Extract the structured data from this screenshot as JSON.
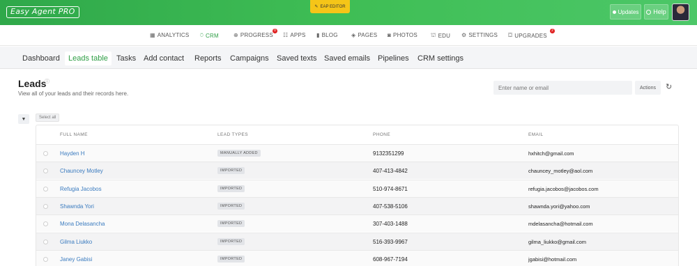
{
  "header": {
    "logo": "Easy Agent PRO",
    "eap_editor": "EAP EDITOR",
    "updates_label": "Updates",
    "help_label": "Help"
  },
  "main_nav": [
    {
      "label": "ANALYTICS",
      "icon": "analytics-icon",
      "glyph": "▦",
      "badge": ""
    },
    {
      "label": "CRM",
      "icon": "crm-icon",
      "glyph": "⍥",
      "badge": ""
    },
    {
      "label": "PROGRESS",
      "icon": "globe-icon",
      "glyph": "⊕",
      "badge": "0"
    },
    {
      "label": "APPS",
      "icon": "apps-icon",
      "glyph": "☷",
      "badge": ""
    },
    {
      "label": "BLOG",
      "icon": "blog-icon",
      "glyph": "▮",
      "badge": ""
    },
    {
      "label": "PAGES",
      "icon": "pages-icon",
      "glyph": "◈",
      "badge": ""
    },
    {
      "label": "PHOTOS",
      "icon": "camera-icon",
      "glyph": "◙",
      "badge": ""
    },
    {
      "label": "EDU",
      "icon": "edu-icon",
      "glyph": "⛫",
      "badge": ""
    },
    {
      "label": "SETTINGS",
      "icon": "gear-icon",
      "glyph": "⚙",
      "badge": ""
    },
    {
      "label": "UPGRADES",
      "icon": "upgrades-icon",
      "glyph": "⛋",
      "badge": "2"
    }
  ],
  "sub_nav": [
    "Dashboard",
    "Leads table",
    "Tasks",
    "Add contact",
    "Reports",
    "Campaigns",
    "Saved texts",
    "Saved emails",
    "Pipelines",
    "CRM settings"
  ],
  "page": {
    "title": "Leads",
    "subtitle": "View all of your leads and their records here.",
    "search_placeholder": "Enter name or email",
    "actions_label": "Actions",
    "select_all": "Select all"
  },
  "table": {
    "headers": [
      "FULL NAME",
      "LEAD TYPES",
      "PHONE",
      "EMAIL"
    ],
    "rows": [
      {
        "name": "Hayden H",
        "type": "MANUALLY ADDED",
        "phone": "9132351299",
        "email": "hxhitch@gmail.com"
      },
      {
        "name": "Chauncey Motley",
        "type": "IMPORTED",
        "phone": "407-413-4842",
        "email": "chauncey_motley@aol.com"
      },
      {
        "name": "Refugia Jacobos",
        "type": "IMPORTED",
        "phone": "510-974-8671",
        "email": "refugia.jacobos@jacobos.com"
      },
      {
        "name": "Shawnda Yori",
        "type": "IMPORTED",
        "phone": "407-538-5106",
        "email": "shawnda.yori@yahoo.com"
      },
      {
        "name": "Mona Delasancha",
        "type": "IMPORTED",
        "phone": "307-403-1488",
        "email": "mdelasancha@hotmail.com"
      },
      {
        "name": "Gilma Liukko",
        "type": "IMPORTED",
        "phone": "516-393-9967",
        "email": "gilma_liukko@gmail.com"
      },
      {
        "name": "Janey Gabisi",
        "type": "IMPORTED",
        "phone": "608-967-7194",
        "email": "jgabisi@hotmail.com"
      }
    ]
  },
  "colors": {
    "brand_green": "#3fbe55",
    "accent": "#2e9e45",
    "link": "#3a7bbf",
    "badge_red": "#e02020",
    "eap_yellow": "#f5c518"
  }
}
